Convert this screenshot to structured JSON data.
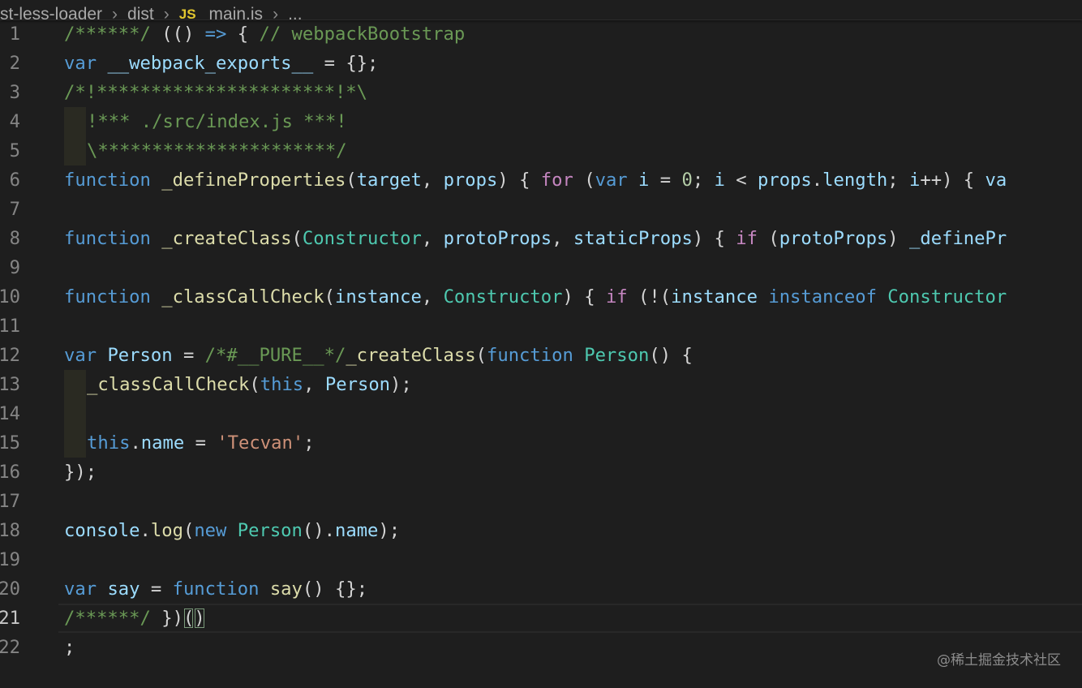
{
  "breadcrumb": {
    "folder_root": "st-less-loader",
    "separator_1": "›",
    "folder_dist": "dist",
    "separator_2": "›",
    "file_icon_label": "JS",
    "file_name": "main.js",
    "separator_3": "›",
    "ellipsis": "..."
  },
  "code_lines": [
    {
      "number": "1",
      "text": "/******/ (() => { // webpackBootstrap"
    },
    {
      "number": "2",
      "text": "var __webpack_exports__ = {};"
    },
    {
      "number": "3",
      "text": "/*!**********************!*\\"
    },
    {
      "number": "4",
      "text": "  !*** ./src/index.js ***!"
    },
    {
      "number": "5",
      "text": "  \\**********************/"
    },
    {
      "number": "6",
      "text": "function _defineProperties(target, props) { for (var i = 0; i < props.length; i++) { va"
    },
    {
      "number": "7",
      "text": ""
    },
    {
      "number": "8",
      "text": "function _createClass(Constructor, protoProps, staticProps) { if (protoProps) _definePr"
    },
    {
      "number": "9",
      "text": ""
    },
    {
      "number": "10",
      "text": "function _classCallCheck(instance, Constructor) { if (!(instance instanceof Constructor"
    },
    {
      "number": "11",
      "text": ""
    },
    {
      "number": "12",
      "text": "var Person = /*#__PURE__*/_createClass(function Person() {"
    },
    {
      "number": "13",
      "text": "  _classCallCheck(this, Person);"
    },
    {
      "number": "14",
      "text": ""
    },
    {
      "number": "15",
      "text": "  this.name = 'Tecvan';"
    },
    {
      "number": "16",
      "text": "});"
    },
    {
      "number": "17",
      "text": ""
    },
    {
      "number": "18",
      "text": "console.log(new Person().name);"
    },
    {
      "number": "19",
      "text": ""
    },
    {
      "number": "20",
      "text": "var say = function say() {};"
    },
    {
      "number": "21",
      "text": "/******/ })()"
    },
    {
      "number": "22",
      "text": ";"
    }
  ],
  "current_line": "21",
  "watermark": "@稀土掘金技术社区",
  "colors": {
    "background": "#1e1e1e",
    "keyword": "#569cd6",
    "comment": "#6a9955",
    "function": "#dcdcaa",
    "variable": "#9cdcfe",
    "control": "#c586c0",
    "string": "#ce9178",
    "number": "#b5cea8",
    "type": "#4ec9b0",
    "js_icon": "#e2c72f"
  }
}
